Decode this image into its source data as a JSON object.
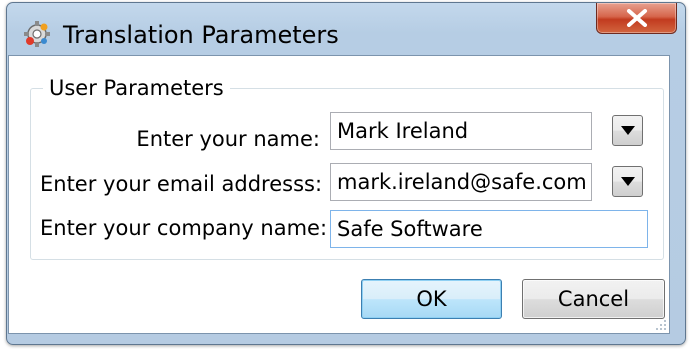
{
  "window": {
    "title": "Translation Parameters",
    "icon": "translation-app-icon",
    "close_icon": "close-x-icon"
  },
  "group": {
    "label": "User Parameters"
  },
  "fields": {
    "name": {
      "label": "Enter your name:",
      "value": "Mark Ireland",
      "has_dropdown": true
    },
    "email": {
      "label": "Enter your email addresss:",
      "value": "mark.ireland@safe.com",
      "has_dropdown": true
    },
    "company": {
      "label": "Enter your company name:",
      "value": "Safe Software",
      "has_dropdown": false
    }
  },
  "buttons": {
    "ok": "OK",
    "cancel": "Cancel"
  },
  "colors": {
    "title_gradient_top": "#c3d8ec",
    "close_red": "#c23b1f",
    "default_button_border": "#3c7fb1"
  }
}
